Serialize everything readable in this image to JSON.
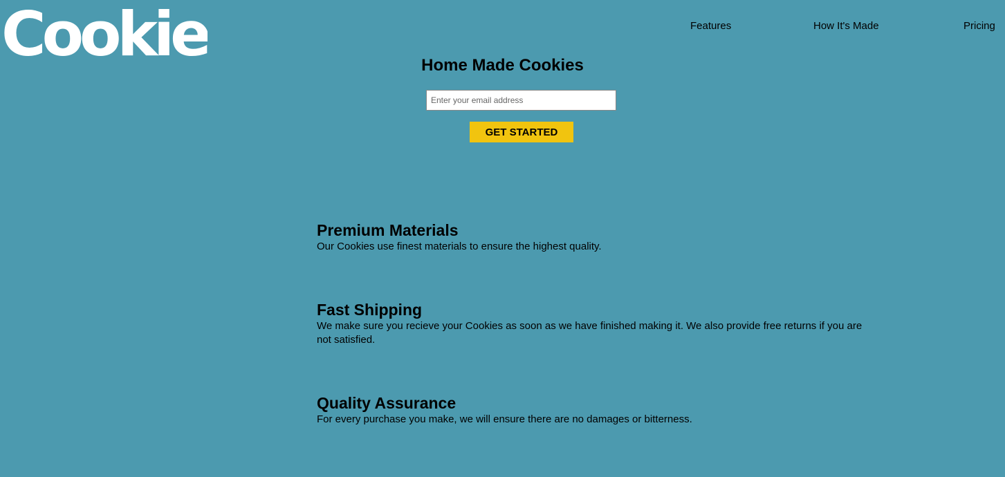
{
  "brand": {
    "logo_text": "Cookies"
  },
  "nav": {
    "items": [
      {
        "label": "Features"
      },
      {
        "label": "How It's Made"
      },
      {
        "label": "Pricing"
      }
    ]
  },
  "hero": {
    "title": "Home Made Cookies",
    "email_placeholder": "Enter your email address",
    "email_value": "",
    "cta_label": "GET STARTED"
  },
  "features": [
    {
      "title": "Premium Materials",
      "description": "Our Cookies use finest materials to ensure the highest quality."
    },
    {
      "title": "Fast Shipping",
      "description": "We make sure you recieve your Cookies as soon as we have finished making it. We also provide free returns if you are not satisfied."
    },
    {
      "title": "Quality Assurance",
      "description": "For every purchase you make, we will ensure there are no damages or bitterness."
    }
  ],
  "colors": {
    "background": "#4c9aaf",
    "cta": "#f1c40f",
    "logo": "#ffffff"
  }
}
